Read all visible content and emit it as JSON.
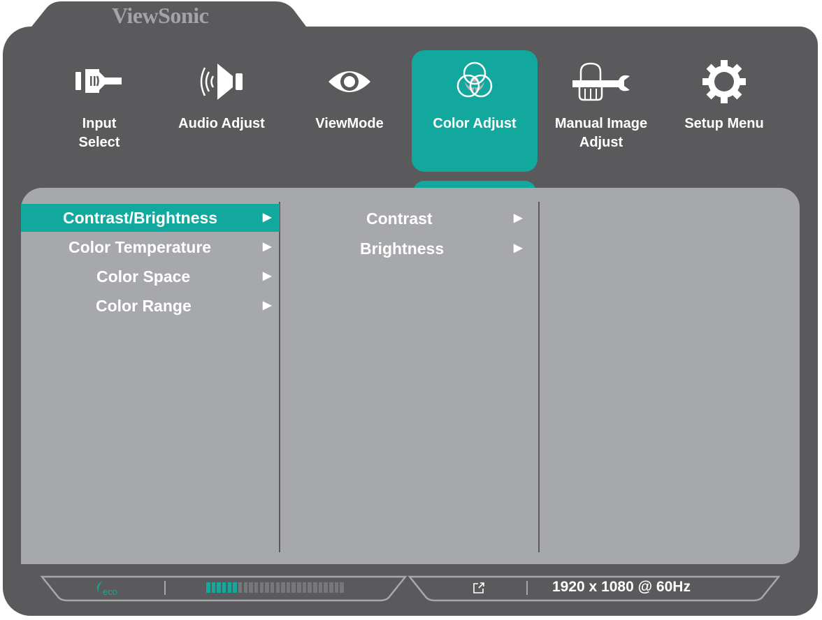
{
  "brand": "ViewSonic",
  "nav": [
    {
      "label_1": "Input",
      "label_2": "Select",
      "icon": "input-icon",
      "active": false
    },
    {
      "label_1": "Audio Adjust",
      "label_2": "",
      "icon": "speaker-icon",
      "active": false
    },
    {
      "label_1": "ViewMode",
      "label_2": "",
      "icon": "eye-icon",
      "active": false
    },
    {
      "label_1": "Color Adjust",
      "label_2": "",
      "icon": "color-circles-icon",
      "active": true
    },
    {
      "label_1": "Manual Image",
      "label_2": "Adjust",
      "icon": "hand-wrench-icon",
      "active": false
    },
    {
      "label_1": "Setup Menu",
      "label_2": "",
      "icon": "gear-icon",
      "active": false
    }
  ],
  "menu_level1": [
    {
      "label": "Contrast/Brightness",
      "arrow": "▶",
      "selected": true
    },
    {
      "label": "Color Temperature",
      "arrow": "▶",
      "selected": false
    },
    {
      "label": "Color Space",
      "arrow": "▶",
      "selected": false
    },
    {
      "label": "Color Range",
      "arrow": "▶",
      "selected": false
    }
  ],
  "menu_level2": [
    {
      "label": "Contrast",
      "arrow": "▶"
    },
    {
      "label": "Brightness",
      "arrow": "▶"
    }
  ],
  "status": {
    "eco_label": "eco",
    "eco_level_segments_filled": 6,
    "eco_level_segments_total": 26,
    "input_icon": "external-link-icon",
    "resolution": "1920 x 1080 @ 60Hz"
  },
  "colors": {
    "accent": "#13a89e",
    "frame": "#5a5a5c",
    "panel": "#a7a8ab",
    "segment_off": "#77777a"
  }
}
